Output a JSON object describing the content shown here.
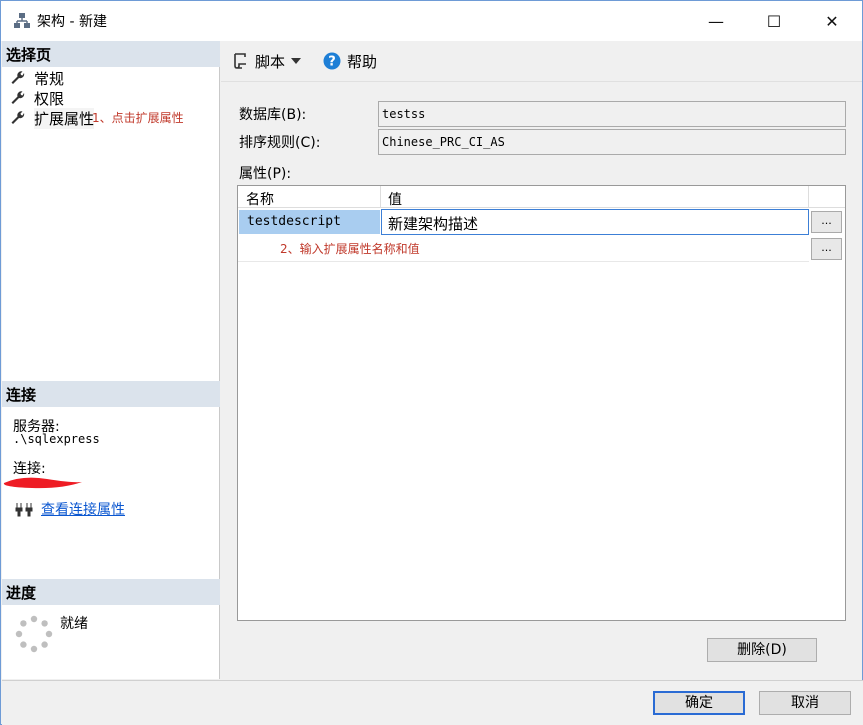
{
  "window": {
    "title": "架构 - 新建",
    "minimize": "—",
    "maximize": "☐",
    "close": "✕"
  },
  "left": {
    "select_page_header": "选择页",
    "pages": [
      {
        "label": "常规",
        "icon": "wrench-icon"
      },
      {
        "label": "权限",
        "icon": "wrench-icon"
      },
      {
        "label": "扩展属性",
        "icon": "wrench-icon"
      }
    ],
    "note1": "1、点击扩展属性",
    "connection_header": "连接",
    "server_label": "服务器:",
    "server_value": ".\\sqlexpress",
    "connection_label": "连接:",
    "view_connection_props": "查看连接属性",
    "progress_header": "进度",
    "progress_status": "就绪"
  },
  "toolbar": {
    "script": "脚本",
    "help": "帮助"
  },
  "form": {
    "database_label": "数据库(B):",
    "database_value": "testss",
    "collation_label": "排序规则(C):",
    "collation_value": "Chinese_PRC_CI_AS",
    "properties_label": "属性(P):"
  },
  "grid": {
    "col_name": "名称",
    "col_value": "值",
    "rows": [
      {
        "name": "testdescript",
        "value": "新建架构描述"
      }
    ],
    "ellipsis": "...",
    "note2": "2、输入扩展属性名称和值"
  },
  "buttons": {
    "delete": "删除(D)",
    "ok": "确定",
    "cancel": "取消"
  },
  "colors": {
    "selection": "#a9cdf0",
    "link": "#0b57d0",
    "note": "#c0392b",
    "header_bg": "#dbe3ec"
  }
}
